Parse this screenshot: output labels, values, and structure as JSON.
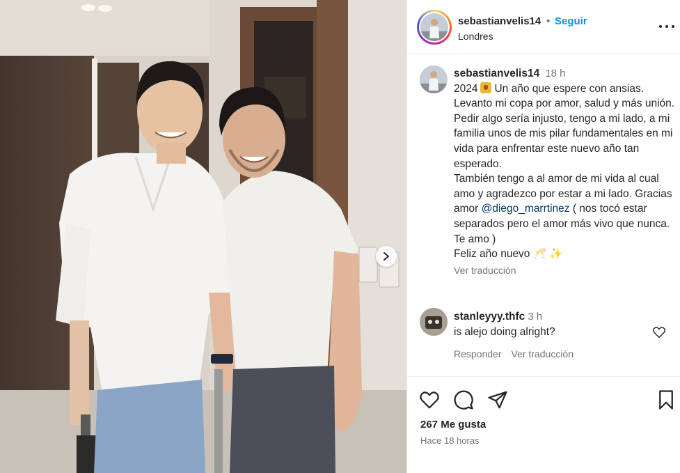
{
  "post": {
    "username": "sebastianvelis14",
    "separator": "•",
    "follow_label": "Seguir",
    "location": "Londres"
  },
  "caption": {
    "username": "sebastianvelis14",
    "time": "18 h",
    "line1_year": "2024",
    "line1_rest": "Un año que espere con ansias. Levanto mi copa por amor, salud y más unión.",
    "para2": "Pedir algo sería injusto, tengo a mi lado, a mi familia unos de mis pilar fundamentales en mi vida para enfrentar este nuevo año tan esperado.",
    "para3_before": "También tengo a al amor de mi vida al cual amo y agradezco por estar a mi lado. Gracias amor ",
    "mention": "@diego_marrtinez",
    "para3_after": " ( nos tocó estar separados pero el amor más vivo que nunca. Te amo )",
    "para4": "Feliz año nuevo 🥂 ✨",
    "translate_label": "Ver traducción"
  },
  "comment": {
    "username": "stanleyyy.thfc",
    "time": "3 h",
    "text": "is alejo doing alright?",
    "reply_label": "Responder",
    "translate_label": "Ver traducción"
  },
  "footer": {
    "likes": "267 Me gusta",
    "posted_ago": "Hace 18 horas"
  },
  "icons": {
    "like": "heart-icon",
    "comment": "comment-icon",
    "share": "share-icon",
    "save": "bookmark-icon",
    "more": "more-icon",
    "next": "chevron-right-icon"
  },
  "colors": {
    "link_blue": "#0095f6",
    "mention": "#00376b",
    "muted": "#737373",
    "text": "#262626"
  }
}
